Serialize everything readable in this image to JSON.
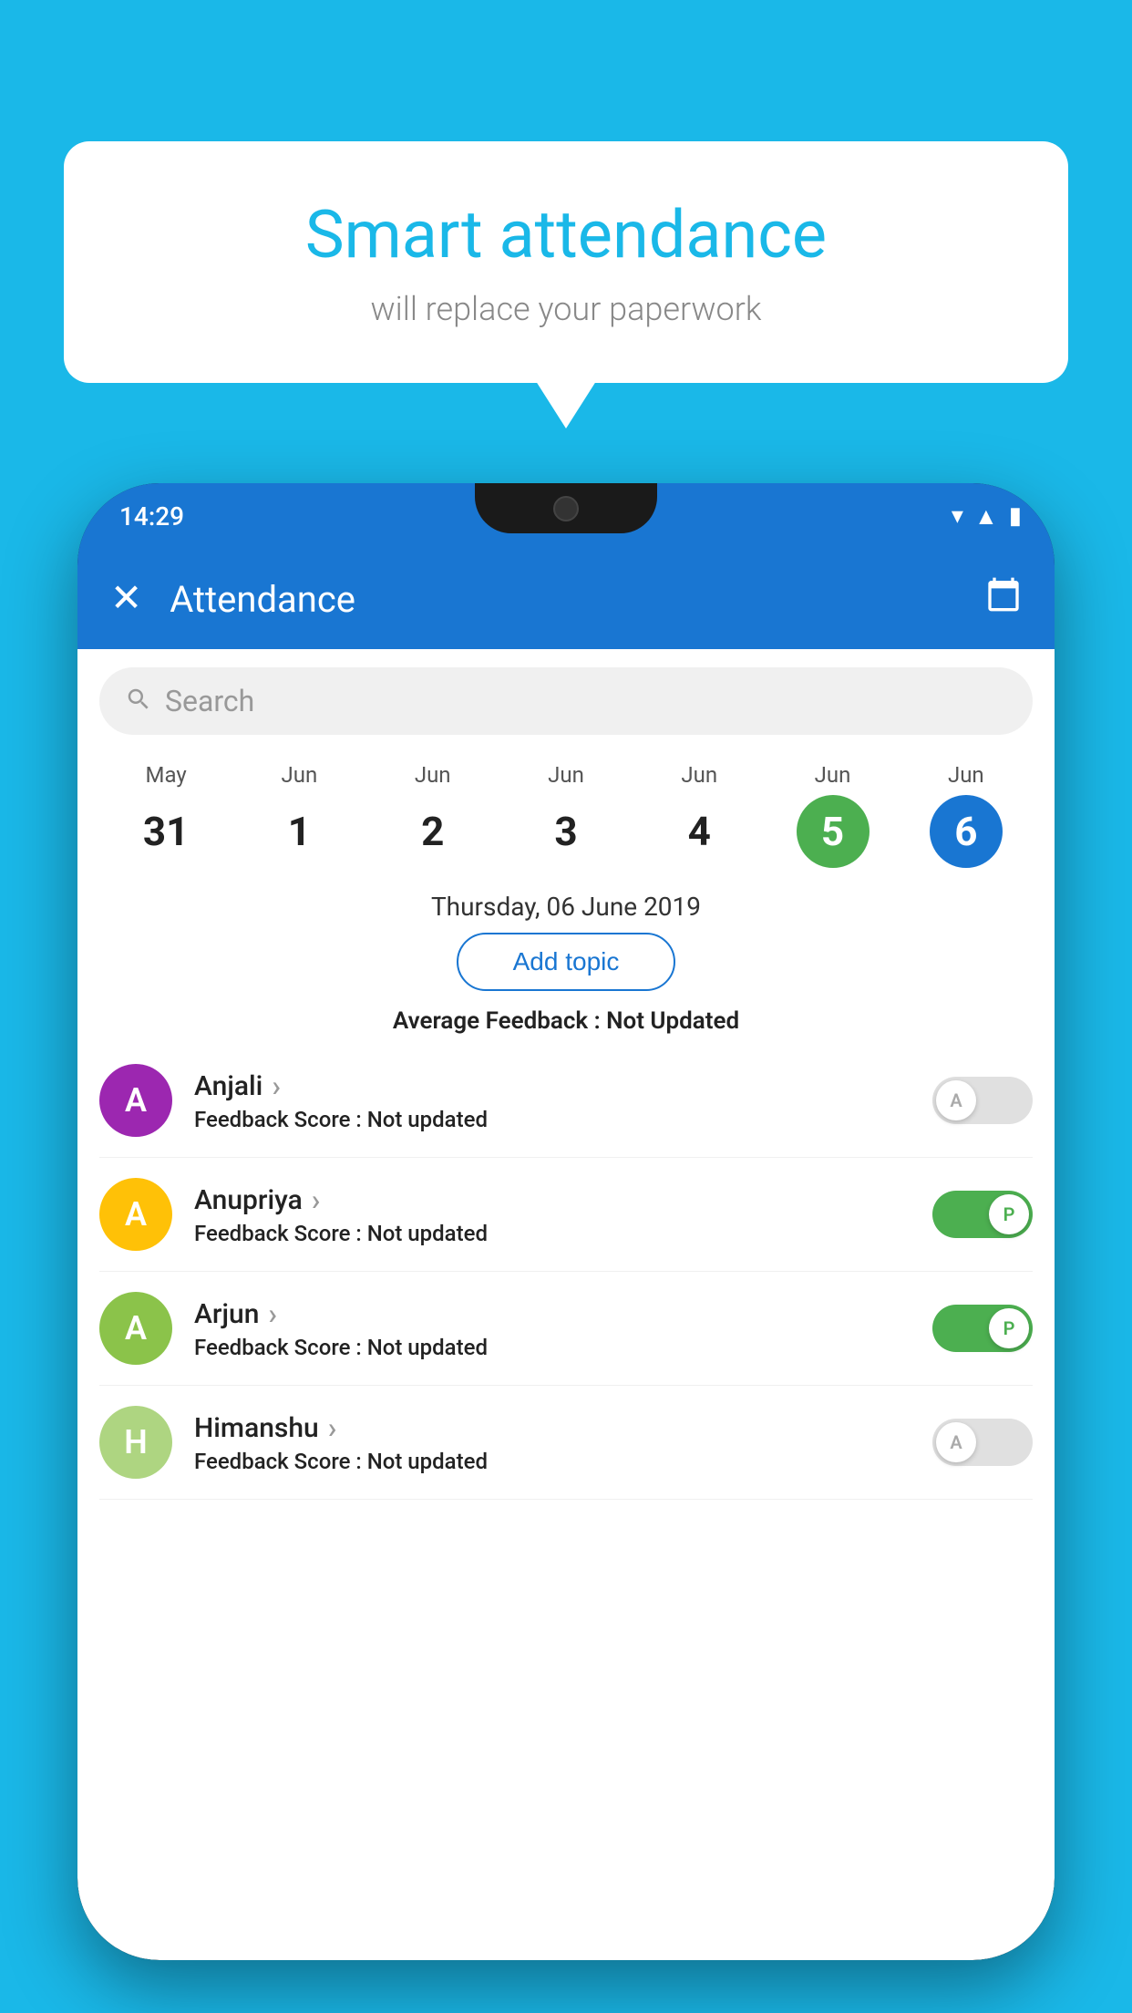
{
  "background_color": "#1ab8e8",
  "speech_bubble": {
    "title": "Smart attendance",
    "subtitle": "will replace your paperwork"
  },
  "status_bar": {
    "time": "14:29",
    "wifi_icon": "▾",
    "signal_icon": "▲",
    "battery_icon": "▮"
  },
  "app_bar": {
    "close_label": "✕",
    "title": "Attendance",
    "calendar_icon": "📅"
  },
  "search": {
    "placeholder": "Search"
  },
  "calendar": {
    "days": [
      {
        "month": "May",
        "date": "31",
        "state": "normal"
      },
      {
        "month": "Jun",
        "date": "1",
        "state": "normal"
      },
      {
        "month": "Jun",
        "date": "2",
        "state": "normal"
      },
      {
        "month": "Jun",
        "date": "3",
        "state": "normal"
      },
      {
        "month": "Jun",
        "date": "4",
        "state": "normal"
      },
      {
        "month": "Jun",
        "date": "5",
        "state": "today"
      },
      {
        "month": "Jun",
        "date": "6",
        "state": "selected"
      }
    ]
  },
  "selected_date": "Thursday, 06 June 2019",
  "add_topic_label": "Add topic",
  "avg_feedback_label": "Average Feedback : ",
  "avg_feedback_value": "Not Updated",
  "students": [
    {
      "name": "Anjali",
      "avatar_letter": "A",
      "avatar_color": "#9c27b0",
      "feedback_label": "Feedback Score : ",
      "feedback_value": "Not updated",
      "attendance": "absent",
      "toggle_label": "A"
    },
    {
      "name": "Anupriya",
      "avatar_letter": "A",
      "avatar_color": "#ffc107",
      "feedback_label": "Feedback Score : ",
      "feedback_value": "Not updated",
      "attendance": "present",
      "toggle_label": "P"
    },
    {
      "name": "Arjun",
      "avatar_letter": "A",
      "avatar_color": "#8bc34a",
      "feedback_label": "Feedback Score : ",
      "feedback_value": "Not updated",
      "attendance": "present",
      "toggle_label": "P"
    },
    {
      "name": "Himanshu",
      "avatar_letter": "H",
      "avatar_color": "#aed581",
      "feedback_label": "Feedback Score : ",
      "feedback_value": "Not updated",
      "attendance": "absent",
      "toggle_label": "A"
    }
  ]
}
